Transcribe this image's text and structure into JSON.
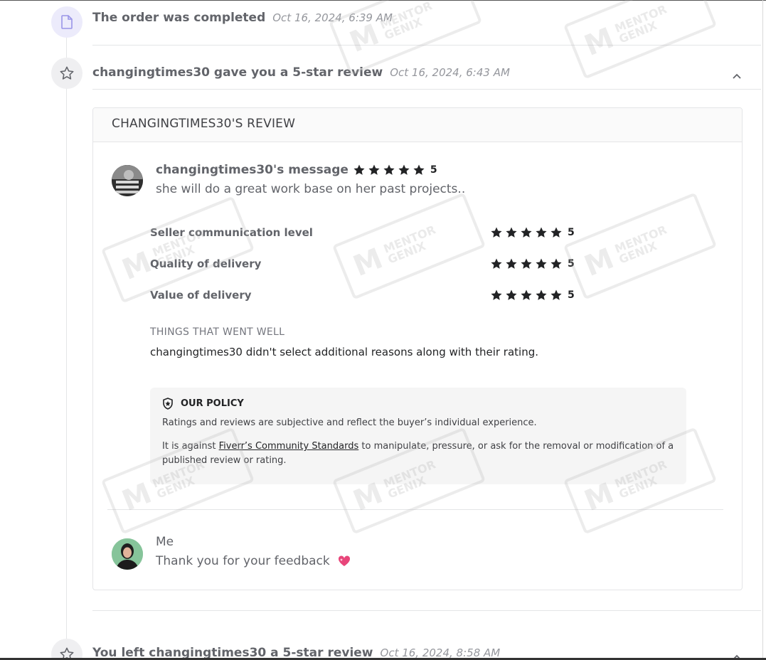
{
  "events": [
    {
      "title": "The order was completed",
      "time": "Oct 16, 2024, 6:39 AM",
      "icon": "document-icon"
    },
    {
      "title": "changingtimes30 gave you a 5-star review",
      "time": "Oct 16, 2024, 6:43 AM",
      "icon": "star-outline-icon"
    },
    {
      "title": "You left changingtimes30 a 5-star review",
      "time": "Oct 16, 2024, 8:58 AM",
      "icon": "star-outline-icon"
    }
  ],
  "review": {
    "header": "CHANGINGTIMES30'S REVIEW",
    "buyer_message_title": "changingtimes30's message",
    "overall_rating": "5",
    "buyer_message": "she will do a great work base on her past projects..",
    "ratings": [
      {
        "label": "Seller communication level",
        "value": "5"
      },
      {
        "label": "Quality of delivery",
        "value": "5"
      },
      {
        "label": "Value of delivery",
        "value": "5"
      }
    ],
    "went_well_title": "THINGS THAT WENT WELL",
    "went_well_text": "changingtimes30 didn't select additional reasons along with their rating.",
    "policy": {
      "title": "OUR POLICY",
      "line1": "Ratings and reviews are subjective and reflect the buyer’s individual experience.",
      "line2_prefix": "It is against ",
      "line2_link": "Fiverr’s Community Standards",
      "line2_suffix": " to manipulate, pressure, or ask for the removal or modification of a published review or rating."
    },
    "reply_name": "Me",
    "reply_text": "Thank you for your feedback"
  },
  "watermark": {
    "line1": "MENTOR",
    "line2": "GENIX"
  },
  "colors": {
    "star": "#222325",
    "doc_icon_bg": "#ecebfb",
    "doc_icon": "#9a95e8",
    "policy_bg": "#f5f5f5"
  }
}
